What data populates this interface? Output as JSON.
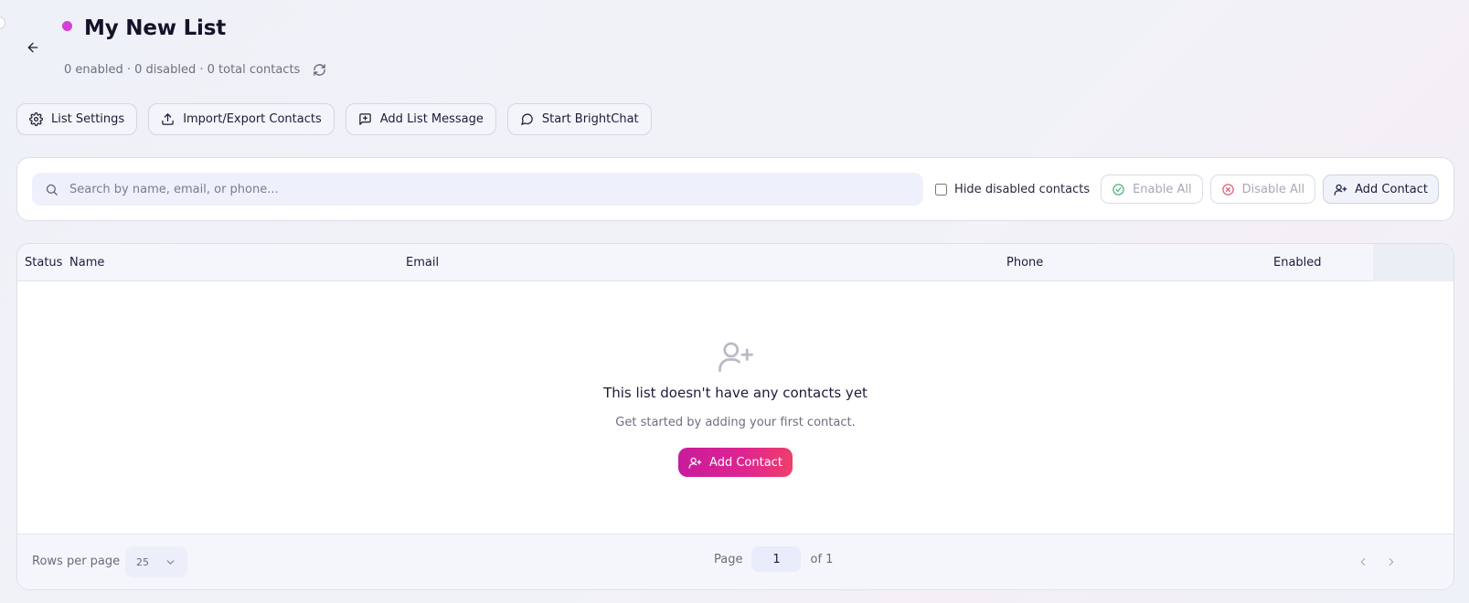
{
  "header": {
    "title": "My New List",
    "subtitle": "0 enabled · 0 disabled · 0 total contacts",
    "dot_color": "#d43fd6"
  },
  "actions": [
    {
      "label": "List Settings",
      "icon": "gear-icon"
    },
    {
      "label": "Import/Export Contacts",
      "icon": "upload-icon"
    },
    {
      "label": "Add List Message",
      "icon": "message-plus-icon"
    },
    {
      "label": "Start BrightChat",
      "icon": "chat-bubble-icon"
    }
  ],
  "toolbar": {
    "search_placeholder": "Search by name, email, or phone...",
    "hide_disabled_label": "Hide disabled contacts",
    "enable_all_label": "Enable All",
    "disable_all_label": "Disable All",
    "add_contact_label": "Add Contact"
  },
  "table": {
    "columns": [
      "Status",
      "Name",
      "Email",
      "Phone",
      "Enabled"
    ]
  },
  "empty_state": {
    "title": "This list doesn't have any contacts yet",
    "subtitle": "Get started by adding your first contact.",
    "cta_label": "Add Contact"
  },
  "footer": {
    "rows_per_page_label": "Rows per page",
    "rows_per_page_value": "25",
    "page_label": "Page",
    "page_value": "1",
    "page_total": "of 1"
  },
  "colors": {
    "accent_start": "#c81b9c",
    "accent_end": "#ef3f6a",
    "enable_icon": "#4fb37a",
    "disable_icon": "#e0607a"
  }
}
